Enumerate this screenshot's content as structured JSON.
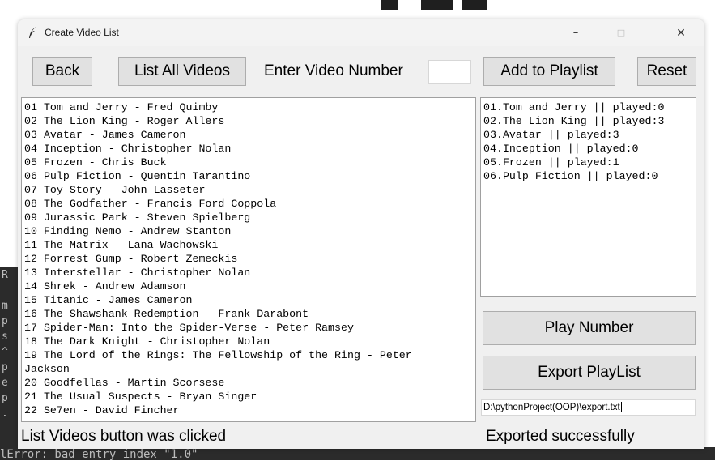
{
  "window": {
    "title": "Create Video List",
    "controls": {
      "minimize": "–",
      "maximize": "□",
      "close": "✕"
    }
  },
  "toolbar": {
    "back_label": "Back",
    "list_all_label": "List All Videos",
    "enter_label": "Enter Video Number",
    "video_number_value": "",
    "add_label": "Add to Playlist",
    "reset_label": "Reset"
  },
  "video_list": [
    "01 Tom and Jerry - Fred Quimby",
    "02 The Lion King - Roger Allers",
    "03 Avatar - James Cameron",
    "04 Inception - Christopher Nolan",
    "05 Frozen - Chris Buck",
    "06 Pulp Fiction - Quentin Tarantino",
    "07 Toy Story - John Lasseter",
    "08 The Godfather - Francis Ford Coppola",
    "09 Jurassic Park - Steven Spielberg",
    "10 Finding Nemo - Andrew Stanton",
    "11 The Matrix - Lana Wachowski",
    "12 Forrest Gump - Robert Zemeckis",
    "13 Interstellar - Christopher Nolan",
    "14 Shrek - Andrew Adamson",
    "15 Titanic - James Cameron",
    "16 The Shawshank Redemption - Frank Darabont",
    "17 Spider-Man: Into the Spider-Verse - Peter Ramsey",
    "18 The Dark Knight - Christopher Nolan",
    "19 The Lord of the Rings: The Fellowship of the Ring - Peter",
    "Jackson",
    "20 Goodfellas - Martin Scorsese",
    "21 The Usual Suspects - Bryan Singer",
    "22 Se7en - David Fincher"
  ],
  "playlist": [
    "01.Tom and Jerry || played:0",
    "02.The Lion King || played:3",
    "03.Avatar || played:3",
    "04.Inception || played:0",
    "05.Frozen || played:1",
    "06.Pulp Fiction || played:0"
  ],
  "actions": {
    "play_label": "Play Number",
    "export_label": "Export PlayList",
    "export_path": "D:\\pythonProject(OOP)\\export.txt"
  },
  "status": {
    "left": "List Videos button was clicked",
    "right": "Exported successfully"
  },
  "background": {
    "side_chars": [
      "R",
      "",
      "m",
      "p",
      "s",
      "^",
      "p",
      "e",
      "p",
      "."
    ],
    "error_text": "lError: bad entry index \"1.0\""
  }
}
